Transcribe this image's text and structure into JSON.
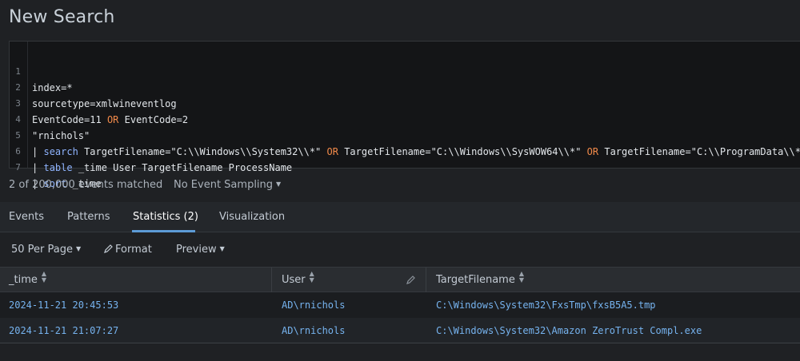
{
  "page_title": "New Search",
  "query_lines": [
    {
      "num": "1",
      "text": "index=*"
    },
    {
      "num": "2",
      "text": "sourcetype=xmlwineventlog"
    },
    {
      "num": "3",
      "parts": [
        "EventCode=11",
        "OR",
        "EventCode=2"
      ]
    },
    {
      "num": "4",
      "text": "\"rnichols\""
    },
    {
      "num": "5",
      "parts": [
        "|",
        "search",
        "TargetFilename=\"C:\\\\Windows\\\\System32\\\\*\"",
        "OR",
        "TargetFilename=\"C:\\\\Windows\\\\SysWOW64\\\\*\"",
        "OR",
        "TargetFilename=\"C:\\\\ProgramData\\\\*\""
      ]
    },
    {
      "num": "6",
      "parts": [
        "|",
        "table",
        "_time User TargetFilename ProcessName"
      ]
    },
    {
      "num": "7",
      "parts": [
        "|",
        "sort",
        "_time"
      ]
    }
  ],
  "status": {
    "match_count": "2 of 200,000 events matched",
    "sampling": "No Event Sampling"
  },
  "tabs": [
    {
      "label": "Events"
    },
    {
      "label": "Patterns"
    },
    {
      "label": "Statistics (2)",
      "active": true
    },
    {
      "label": "Visualization"
    }
  ],
  "toolbar": {
    "per_page": "50 Per Page",
    "format": "Format",
    "preview": "Preview"
  },
  "table": {
    "columns": [
      "_time",
      "User",
      "TargetFilename"
    ],
    "rows": [
      [
        "2024-11-21 20:45:53",
        "AD\\rnichols",
        "C:\\Windows\\System32\\FxsTmp\\fxsB5A5.tmp"
      ],
      [
        "2024-11-21 21:07:27",
        "AD\\rnichols",
        "C:\\Windows\\System32\\Amazon ZeroTrust Compl.exe"
      ]
    ]
  },
  "colors": {
    "accent": "#5c9bd6",
    "keyword": "#8fb4ff",
    "operator": "#f28a4a",
    "cell_link": "#76b3ef"
  }
}
